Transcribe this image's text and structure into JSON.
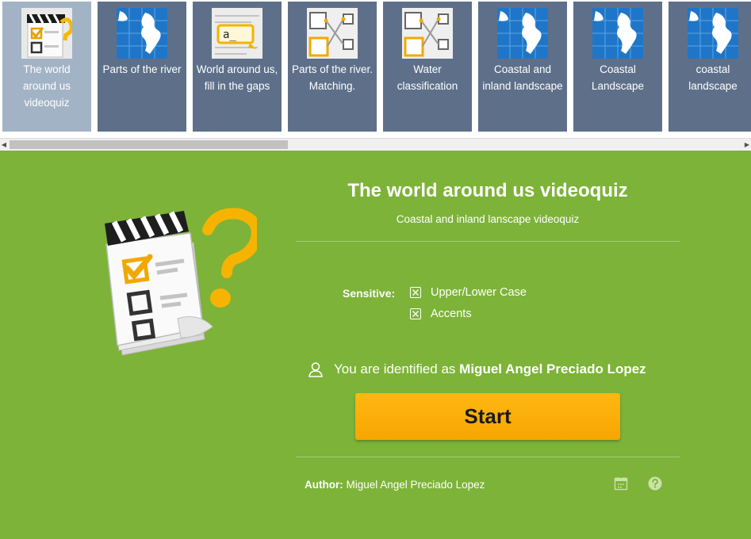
{
  "activities": [
    {
      "label": "The world around us videoquiz",
      "icon": "videoquiz-icon",
      "active": true
    },
    {
      "label": "Parts of the river",
      "icon": "globe-icon",
      "active": false
    },
    {
      "label": "World around us, fill in the gaps",
      "icon": "fill-gaps-icon",
      "active": false
    },
    {
      "label": "Parts of the river. Matching.",
      "icon": "matching-icon",
      "active": false
    },
    {
      "label": "Water classification",
      "icon": "matching-icon",
      "active": false
    },
    {
      "label": "Coastal and inland landscape",
      "icon": "globe-icon",
      "active": false
    },
    {
      "label": "Coastal Landscape",
      "icon": "globe-icon",
      "active": false
    },
    {
      "label": "coastal landscape",
      "icon": "globe-icon",
      "active": false
    }
  ],
  "quiz": {
    "title": "The world around us videoquiz",
    "subtitle": "Coastal and inland lanscape videoquiz",
    "sensitive_label": "Sensitive:",
    "options": [
      {
        "label": "Upper/Lower Case",
        "checked": true
      },
      {
        "label": "Accents",
        "checked": true
      }
    ],
    "identified_prefix": "You are identified as",
    "user_name": "Miguel Angel Preciado Lopez",
    "start_label": "Start",
    "author_label": "Author:",
    "author_name": "Miguel Angel Preciado Lopez"
  },
  "scroll": {
    "position": 0.0
  },
  "colors": {
    "background": "#7db338",
    "tile": "#5e7089",
    "tile_active": "#a3b3c6",
    "start_button": "#ffb010",
    "globe_blue": "#1f76c8"
  }
}
